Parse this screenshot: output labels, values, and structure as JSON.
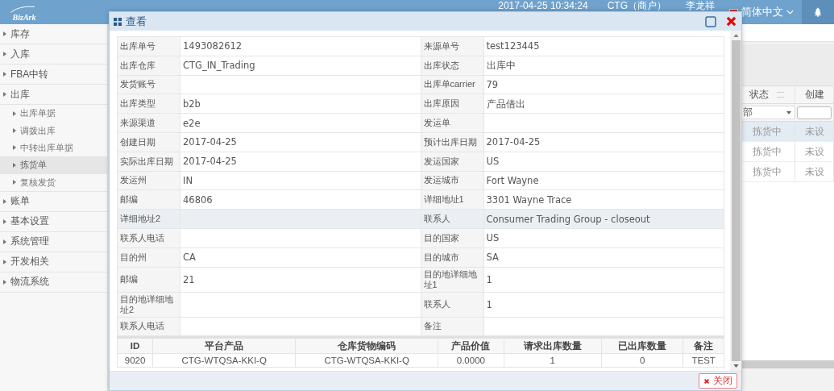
{
  "header": {
    "logo": "BizArk",
    "datetime": "2017-04-25 10:34:24",
    "merchant": "CTG（商户）",
    "user": "李龙祥",
    "language": "简体中文"
  },
  "sidebar": {
    "items": [
      {
        "label": "库存"
      },
      {
        "label": "入库"
      },
      {
        "label": "FBA中转"
      },
      {
        "label": "出库",
        "children": [
          {
            "label": "出库单据",
            "selected": false
          },
          {
            "label": "调拨出库",
            "selected": false
          },
          {
            "label": "中转出库单据",
            "selected": false
          },
          {
            "label": "拣货单",
            "selected": true
          },
          {
            "label": "复核发货",
            "selected": false
          }
        ]
      },
      {
        "label": "账单"
      },
      {
        "label": "基本设置"
      },
      {
        "label": "系统管理"
      },
      {
        "label": "开发相关"
      },
      {
        "label": "物流系统"
      }
    ]
  },
  "background_grid": {
    "columns": [
      "状态",
      "创建"
    ],
    "filter": {
      "value": "部"
    },
    "rows": [
      {
        "cells": [
          "拣货中",
          "未设"
        ],
        "selected": true
      },
      {
        "cells": [
          "拣货中",
          "未设"
        ],
        "selected": false
      },
      {
        "cells": [
          "拣货中",
          "未设"
        ],
        "selected": false
      }
    ]
  },
  "dialog": {
    "title": "查看",
    "details": [
      {
        "highlighted": false,
        "cells": [
          {
            "label": "出库单号",
            "value": "1493082612"
          },
          {
            "label": "来源单号",
            "value": "test123445"
          }
        ]
      },
      {
        "highlighted": false,
        "cells": [
          {
            "label": "出库仓库",
            "value": "CTG_IN_Trading"
          },
          {
            "label": "出库状态",
            "value": "出库中"
          }
        ]
      },
      {
        "highlighted": false,
        "cells": [
          {
            "label": "发货账号"
          },
          {
            "label": "出库单carrier",
            "value": "79"
          }
        ]
      },
      {
        "highlighted": false,
        "cells": [
          {
            "label": "出库类型",
            "value": "b2b"
          },
          {
            "label": "出库原因",
            "value": "产品借出"
          }
        ]
      },
      {
        "highlighted": false,
        "cells": [
          {
            "label": "来源渠道",
            "value": "e2e"
          },
          {
            "label": "发运单"
          }
        ]
      },
      {
        "highlighted": false,
        "cells": [
          {
            "label": "创建日期",
            "value": "2017-04-25"
          },
          {
            "label": "预计出库日期",
            "value": "2017-04-25"
          }
        ]
      },
      {
        "highlighted": false,
        "cells": [
          {
            "label": "实际出库日期",
            "value": "2017-04-25"
          },
          {
            "label": "发运国家",
            "value": "US"
          }
        ]
      },
      {
        "highlighted": false,
        "cells": [
          {
            "label": "发运州",
            "value": "IN"
          },
          {
            "label": "发运城市",
            "value": "Fort Wayne"
          }
        ]
      },
      {
        "highlighted": false,
        "cells": [
          {
            "label": "邮编",
            "value": "46806"
          },
          {
            "label": "详细地址1",
            "value": "3301 Wayne Trace"
          }
        ]
      },
      {
        "highlighted": true,
        "cells": [
          {
            "label": "详细地址2"
          },
          {
            "label": "联系人",
            "value": "Consumer Trading Group - closeout"
          }
        ]
      },
      {
        "highlighted": false,
        "cells": [
          {
            "label": "联系人电话"
          },
          {
            "label": "目的国家",
            "value": "US"
          }
        ]
      },
      {
        "highlighted": false,
        "cells": [
          {
            "label": "目的州",
            "value": "CA"
          },
          {
            "label": "目的城市",
            "value": "SA"
          }
        ]
      },
      {
        "highlighted": false,
        "cells": [
          {
            "label": "邮编",
            "value": "21"
          },
          {
            "label": "目的地详细地址1",
            "value": "1"
          }
        ]
      },
      {
        "highlighted": false,
        "cells": [
          {
            "label": "目的地详细地址2"
          },
          {
            "label": "联系人",
            "value": "1"
          }
        ]
      },
      {
        "highlighted": false,
        "cells": [
          {
            "label": "联系人电话"
          },
          {
            "label": "备注"
          }
        ]
      }
    ],
    "items_table": {
      "columns": [
        "ID",
        "平台产品",
        "仓库货物编码",
        "产品价值",
        "请求出库数量",
        "已出库数量",
        "备注"
      ],
      "rows": [
        [
          "9020",
          "CTG-WTQSA-KKI-Q",
          "CTG-WTQSA-KKI-Q",
          "0.0000",
          "1",
          "0",
          "TEST"
        ]
      ]
    },
    "close_button": "关闭"
  }
}
